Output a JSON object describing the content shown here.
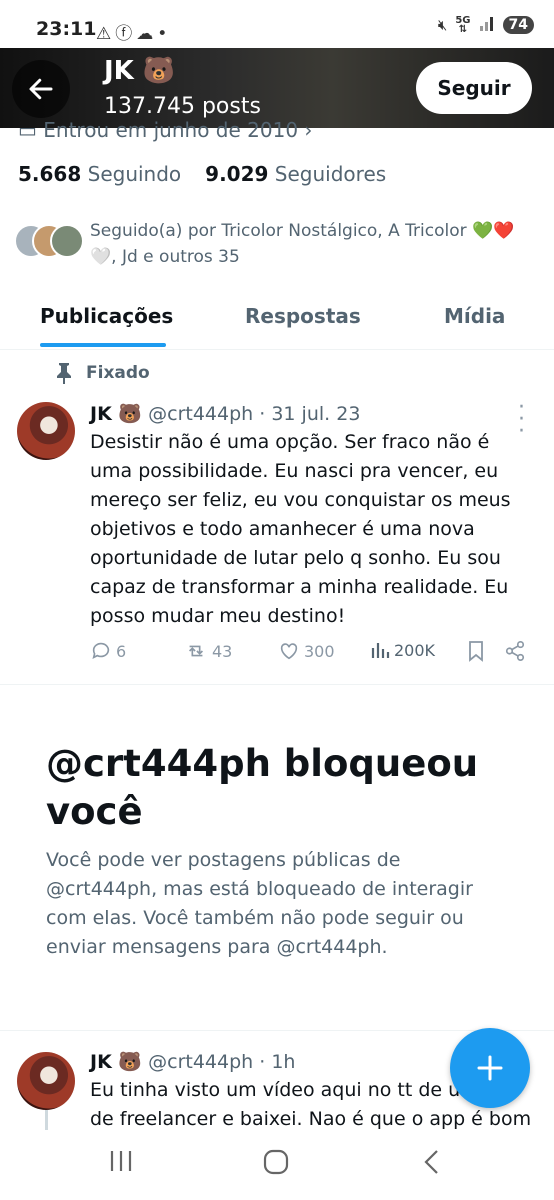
{
  "status_bar": {
    "time": "23:11",
    "left_icons": [
      "warning-icon",
      "facebook-icon",
      "cloud-icon",
      "dot-icon"
    ],
    "network_label": "5G",
    "battery": "74"
  },
  "header": {
    "name": "JK 🐻",
    "posts": "137.745 posts",
    "follow_label": "Seguir"
  },
  "profile": {
    "joined": "Entrou em junho de 2010",
    "following_count": "5.668",
    "following_label": "Seguindo",
    "followers_count": "9.029",
    "followers_label": "Seguidores",
    "followed_by": "Seguido(a) por Tricolor Nostálgico, A Tricolor 💚❤️🤍, Jd e outros 35"
  },
  "tabs": [
    {
      "label": "Publicações",
      "active": true
    },
    {
      "label": "Respostas",
      "active": false
    },
    {
      "label": "Mídia",
      "active": false
    }
  ],
  "pinned_tweet": {
    "pinned_label": "Fixado",
    "name": "JK 🐻",
    "handle": "@crt444ph",
    "date": "· 31 jul. 23",
    "text": "Desistir não é uma opção. Ser fraco não é uma possibilidade. Eu nasci pra vencer, eu mereço ser feliz, eu vou conquistar os meus objetivos e todo amanhecer é uma nova oportunidade de lutar pelo q sonho. Eu sou capaz de transformar a minha realidade. Eu posso mudar meu destino!",
    "replies": "6",
    "retweets": "43",
    "likes": "300",
    "views": "200K"
  },
  "blocked": {
    "title": "@crt444ph bloqueou você",
    "description": "Você pode ver postagens públicas de @crt444ph, mas está bloqueado de interagir com elas. Você também não pode seguir ou enviar mensagens para @crt444ph."
  },
  "second_tweet": {
    "name": "JK 🐻",
    "handle": "@crt444ph",
    "time": "· 1h",
    "text": "Eu tinha visto um vídeo aqui no tt de um app de freelancer e baixei. Nao é que o app é bom"
  },
  "colors": {
    "accent": "#1d9bf0",
    "text_primary": "#0f1419",
    "text_secondary": "#536471"
  }
}
